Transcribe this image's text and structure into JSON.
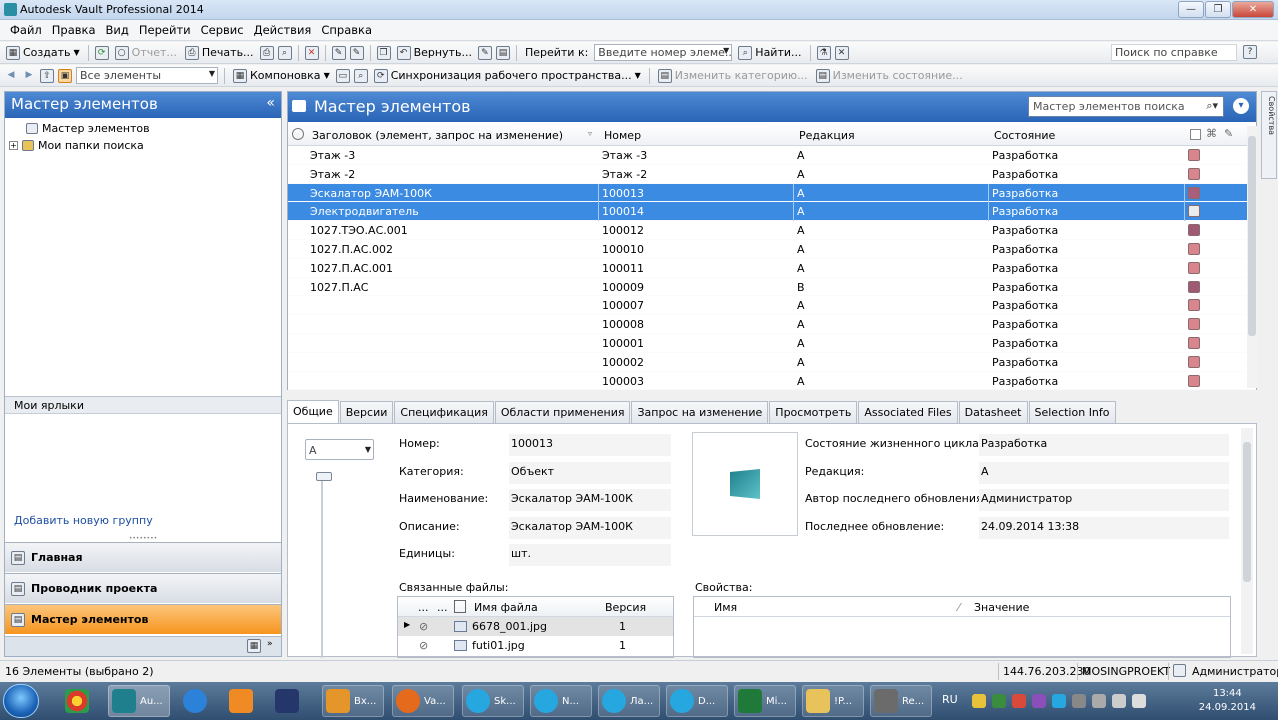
{
  "window": {
    "title": "Autodesk Vault Professional 2014"
  },
  "menu": [
    "Файл",
    "Правка",
    "Вид",
    "Перейти",
    "Сервис",
    "Действия",
    "Справка"
  ],
  "toolbar1": {
    "create": "Создать",
    "report": "Отчет...",
    "print": "Печать...",
    "back": "Вернуть...",
    "goto": "Перейти к:",
    "goto_placeholder": "Введите номер элеме...",
    "find": "Найти...",
    "help_search": "Поиск по справке"
  },
  "toolbar2": {
    "filter": "Все элементы",
    "layout": "Компоновка",
    "sync": "Синхронизация рабочего пространства...",
    "change_category": "Изменить категорию...",
    "change_state": "Изменить состояние..."
  },
  "left": {
    "title": "Мастер элементов",
    "tree": [
      "Мастер элементов",
      "Мои папки поиска"
    ],
    "shortcuts": "Мои ярлыки",
    "add_group": "Добавить новую группу",
    "nav": [
      "Главная",
      "Проводник проекта",
      "Мастер элементов"
    ]
  },
  "main": {
    "title": "Мастер элементов",
    "search_placeholder": "Мастер элементов поиска",
    "columns": [
      "Заголовок (элемент, запрос на изменение)",
      "Номер",
      "Редакция",
      "Состояние"
    ],
    "rows": [
      {
        "title": "Этаж -3",
        "number": "Этаж -3",
        "rev": "A",
        "state": "Разработка",
        "color": "#d9858d",
        "sel": false
      },
      {
        "title": "Этаж -2",
        "number": "Этаж -2",
        "rev": "A",
        "state": "Разработка",
        "color": "#d9858d",
        "sel": false
      },
      {
        "title": "Эскалатор ЭАМ-100К",
        "number": "100013",
        "rev": "A",
        "state": "Разработка",
        "color": "#a95e7c",
        "sel": true
      },
      {
        "title": "Электродвигатель",
        "number": "100014",
        "rev": "A",
        "state": "Разработка",
        "color": "#e8ecf1",
        "sel": true
      },
      {
        "title": "1027.ТЭО.АС.001",
        "number": "100012",
        "rev": "A",
        "state": "Разработка",
        "color": "#9e5a75",
        "sel": false
      },
      {
        "title": "1027.П.АС.002",
        "number": "100010",
        "rev": "A",
        "state": "Разработка",
        "color": "#d9858d",
        "sel": false
      },
      {
        "title": "1027.П.АС.001",
        "number": "100011",
        "rev": "A",
        "state": "Разработка",
        "color": "#d9858d",
        "sel": false
      },
      {
        "title": "1027.П.АС",
        "number": "100009",
        "rev": "B",
        "state": "Разработка",
        "color": "#9e5a75",
        "sel": false
      },
      {
        "title": "",
        "number": "100007",
        "rev": "A",
        "state": "Разработка",
        "color": "#d9858d",
        "sel": false
      },
      {
        "title": "",
        "number": "100008",
        "rev": "A",
        "state": "Разработка",
        "color": "#d9858d",
        "sel": false
      },
      {
        "title": "",
        "number": "100001",
        "rev": "A",
        "state": "Разработка",
        "color": "#d9858d",
        "sel": false
      },
      {
        "title": "",
        "number": "100002",
        "rev": "A",
        "state": "Разработка",
        "color": "#d9858d",
        "sel": false
      },
      {
        "title": "",
        "number": "100003",
        "rev": "A",
        "state": "Разработка",
        "color": "#d9858d",
        "sel": false
      }
    ]
  },
  "tabs": [
    "Общие",
    "Версии",
    "Спецификация",
    "Области применения",
    "Запрос на изменение",
    "Просмотреть",
    "Associated Files",
    "Datasheet",
    "Selection Info"
  ],
  "details": {
    "rev_select": "A",
    "left_fields": [
      {
        "label": "Номер:",
        "value": "100013"
      },
      {
        "label": "Категория:",
        "value": "Объект"
      },
      {
        "label": "Наименование:",
        "value": "Эскалатор ЭАМ-100К"
      },
      {
        "label": "Описание:",
        "value": "Эскалатор ЭАМ-100К"
      },
      {
        "label": "Единицы:",
        "value": "шт."
      }
    ],
    "right_fields": [
      {
        "label": "Состояние жизненного цикла:",
        "value": "Разработка"
      },
      {
        "label": "Редакция:",
        "value": "A"
      },
      {
        "label": "Автор последнего обновления:",
        "value": "Администратор"
      },
      {
        "label": "Последнее обновление:",
        "value": "24.09.2014 13:38"
      }
    ],
    "files_label": "Связанные файлы:",
    "files_cols": [
      "...",
      "...",
      "Имя файла",
      "Версия"
    ],
    "files": [
      {
        "name": "6678_001.jpg",
        "ver": "1"
      },
      {
        "name": "futi01.jpg",
        "ver": "1"
      }
    ],
    "props_label": "Свойства:",
    "props_cols": [
      "Имя",
      "Значение"
    ]
  },
  "status": {
    "left": "16 Элементы (выбрано 2)",
    "ip": "144.76.203.230",
    "server": "MOSINGPROEKT",
    "user": "Администратор"
  },
  "taskbar": {
    "apps": [
      "Au...",
      "Вх...",
      "Va...",
      "Sk...",
      "N...",
      "Ла...",
      "D...",
      "Mi...",
      "!P...",
      "Re..."
    ],
    "lang": "RU",
    "time": "13:44",
    "date": "24.09.2014"
  }
}
